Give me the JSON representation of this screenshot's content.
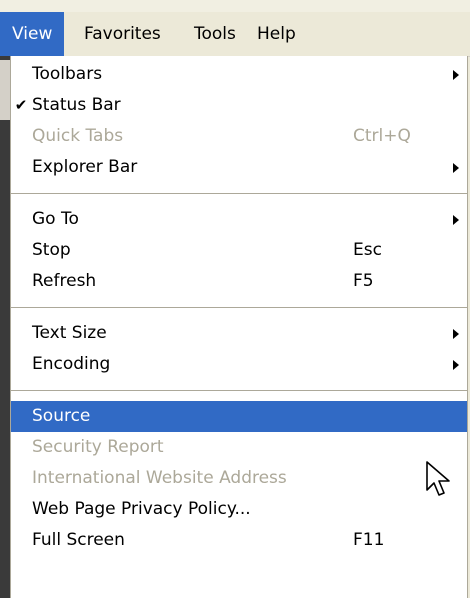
{
  "menubar": {
    "items": [
      {
        "label": "View",
        "active": true
      },
      {
        "label": "Favorites",
        "active": false
      },
      {
        "label": "Tools",
        "active": false
      },
      {
        "label": "Help",
        "active": false
      }
    ]
  },
  "menu": {
    "items": [
      {
        "label": "Toolbars",
        "shortcut": "",
        "submenu": true,
        "checked": false,
        "disabled": false,
        "highlighted": false
      },
      {
        "label": "Status Bar",
        "shortcut": "",
        "submenu": false,
        "checked": true,
        "disabled": false,
        "highlighted": false
      },
      {
        "label": "Quick Tabs",
        "shortcut": "Ctrl+Q",
        "submenu": false,
        "checked": false,
        "disabled": true,
        "highlighted": false
      },
      {
        "label": "Explorer Bar",
        "shortcut": "",
        "submenu": true,
        "checked": false,
        "disabled": false,
        "highlighted": false
      },
      {
        "label": "Go To",
        "shortcut": "",
        "submenu": true,
        "checked": false,
        "disabled": false,
        "highlighted": false
      },
      {
        "label": "Stop",
        "shortcut": "Esc",
        "submenu": false,
        "checked": false,
        "disabled": false,
        "highlighted": false
      },
      {
        "label": "Refresh",
        "shortcut": "F5",
        "submenu": false,
        "checked": false,
        "disabled": false,
        "highlighted": false
      },
      {
        "label": "Text Size",
        "shortcut": "",
        "submenu": true,
        "checked": false,
        "disabled": false,
        "highlighted": false
      },
      {
        "label": "Encoding",
        "shortcut": "",
        "submenu": true,
        "checked": false,
        "disabled": false,
        "highlighted": false
      },
      {
        "label": "Source",
        "shortcut": "",
        "submenu": false,
        "checked": false,
        "disabled": false,
        "highlighted": true
      },
      {
        "label": "Security Report",
        "shortcut": "",
        "submenu": false,
        "checked": false,
        "disabled": true,
        "highlighted": false
      },
      {
        "label": "International Website Address",
        "shortcut": "",
        "submenu": false,
        "checked": false,
        "disabled": true,
        "highlighted": false
      },
      {
        "label": "Web Page Privacy Policy...",
        "shortcut": "",
        "submenu": false,
        "checked": false,
        "disabled": false,
        "highlighted": false
      },
      {
        "label": "Full Screen",
        "shortcut": "F11",
        "submenu": false,
        "checked": false,
        "disabled": false,
        "highlighted": false
      }
    ],
    "check_glyph": "✔"
  },
  "colors": {
    "highlight": "#316ac5",
    "disabled_text": "#aca899",
    "menu_background": "#ffffff",
    "menubar_background": "#ece9d8"
  },
  "icons": {
    "cursor": "arrow-cursor-icon",
    "submenu": "submenu-arrow-icon",
    "check": "checkmark-icon"
  }
}
